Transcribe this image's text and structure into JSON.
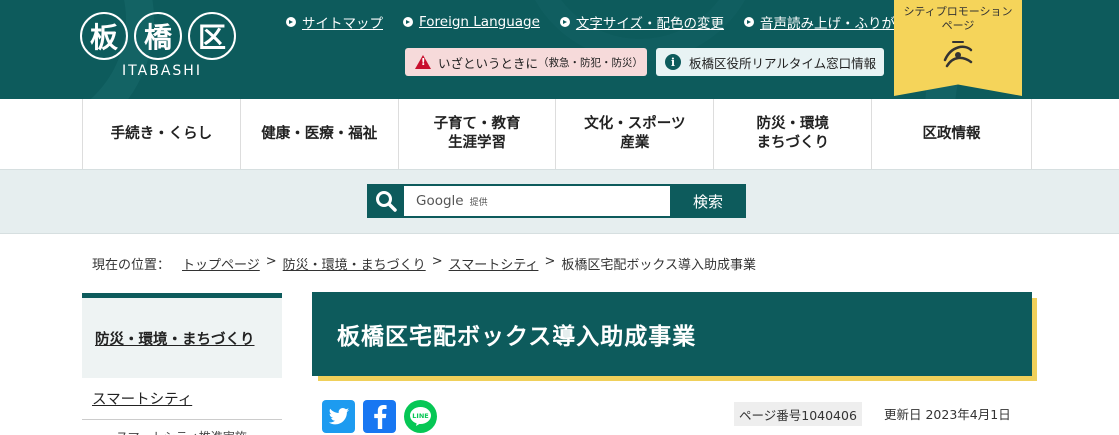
{
  "header": {
    "logo_chars": [
      "板",
      "橋",
      "区"
    ],
    "logo_sub": "ITABASHI",
    "top_links": [
      {
        "label": "サイトマップ"
      },
      {
        "label": "Foreign Language"
      },
      {
        "label": "文字サイズ・配色の変更"
      },
      {
        "label": "音声読み上げ・ふりがな"
      }
    ],
    "emergency": {
      "main": "いざというときに",
      "sub": "（救急・防犯・防災）"
    },
    "realtime": {
      "label": "板橋区役所リアルタイム窓口情報"
    },
    "promo": {
      "line1": "シティプロモーション",
      "line2": "ページ"
    }
  },
  "global_nav": [
    {
      "label": "手続き・くらし"
    },
    {
      "label": "健康・医療・福祉"
    },
    {
      "label": "子育て・教育\n生涯学習"
    },
    {
      "label": "文化・スポーツ\n産業"
    },
    {
      "label": "防災・環境\nまちづくり"
    },
    {
      "label": "区政情報"
    }
  ],
  "search": {
    "google": "Google",
    "provided": "提供",
    "button": "検索"
  },
  "breadcrumb": {
    "label": "現在の位置：",
    "items": [
      "トップページ",
      "防災・環境・まちづくり",
      "スマートシティ"
    ],
    "current": "板橋区宅配ボックス導入助成事業"
  },
  "sidebar": {
    "heading": "防災・環境・まちづくり",
    "item": "スマートシティ",
    "sub": "スマートシティ推進実施"
  },
  "page": {
    "title": "板橋区宅配ボックス導入助成事業",
    "page_number": "ページ番号1040406",
    "updated": "更新日 2023年4月1日"
  },
  "colors": {
    "brand": "#0d5b5c",
    "accent": "#f5d45a",
    "emergency_bg": "#f6dada",
    "twitter": "#1d9bf0",
    "facebook": "#1877f2",
    "line": "#06c755"
  },
  "icons": [
    "search-icon",
    "warning-icon",
    "info-icon",
    "twitter-icon",
    "facebook-icon",
    "line-icon",
    "arrow-right-icon"
  ]
}
